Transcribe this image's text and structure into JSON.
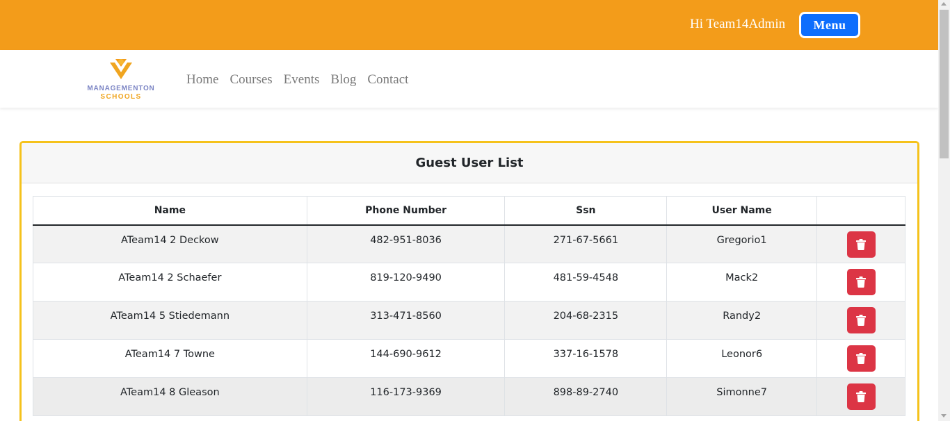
{
  "header": {
    "greeting": "Hi Team14Admin",
    "menu_label": "Menu"
  },
  "brand": {
    "line1": "MANAGEMENTON",
    "line2": "SCHOOLS"
  },
  "nav": {
    "items": [
      "Home",
      "Courses",
      "Events",
      "Blog",
      "Contact"
    ]
  },
  "card": {
    "title": "Guest User List"
  },
  "table": {
    "columns": [
      "Name",
      "Phone Number",
      "Ssn",
      "User Name",
      ""
    ],
    "rows": [
      {
        "name": "ATeam14 2 Deckow",
        "phone": "482-951-8036",
        "ssn": "271-67-5661",
        "username": "Gregorio1"
      },
      {
        "name": "ATeam14 2 Schaefer",
        "phone": "819-120-9490",
        "ssn": "481-59-4548",
        "username": "Mack2"
      },
      {
        "name": "ATeam14 5 Stiedemann",
        "phone": "313-471-8560",
        "ssn": "204-68-2315",
        "username": "Randy2"
      },
      {
        "name": "ATeam14 7 Towne",
        "phone": "144-690-9612",
        "ssn": "337-16-1578",
        "username": "Leonor6"
      },
      {
        "name": "ATeam14 8 Gleason",
        "phone": "116-173-9369",
        "ssn": "898-89-2740",
        "username": "Simonne7"
      }
    ],
    "row_action_icon": "trash-icon"
  },
  "colors": {
    "topbar": "#f39c1a",
    "menu_button": "#0d6efd",
    "card_border": "#f5c21b",
    "delete_button": "#dc3545",
    "brand_purple": "#7b84c4",
    "brand_orange": "#f0a520"
  }
}
